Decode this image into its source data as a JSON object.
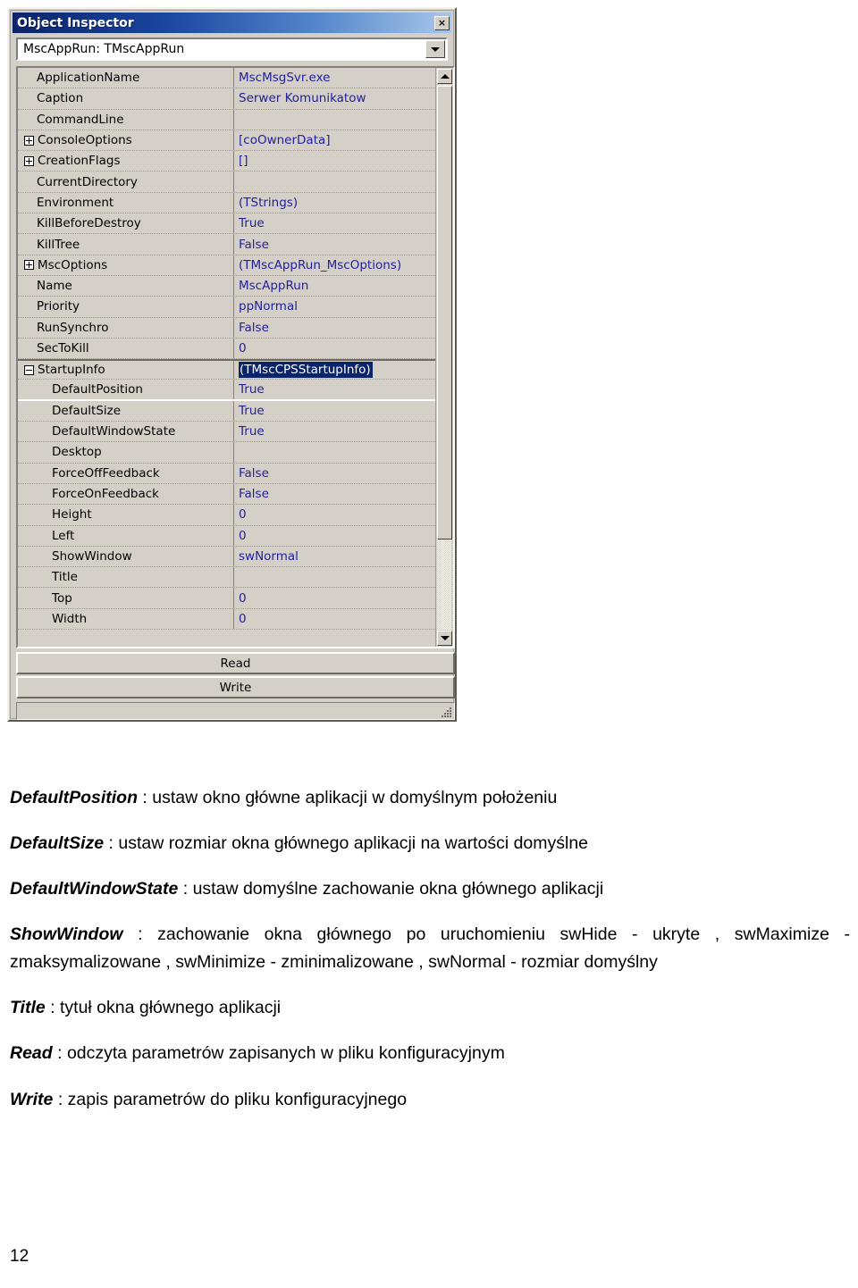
{
  "window": {
    "title": "Object Inspector",
    "close_label": "×",
    "component_selector": "MscAppRun: TMscAppRun",
    "buttons": {
      "read": "Read",
      "write": "Write"
    }
  },
  "properties": [
    {
      "name": "ApplicationName",
      "value": "MscMsgSvr.exe",
      "indent": 0,
      "expander": "",
      "selected": false
    },
    {
      "name": "Caption",
      "value": "Serwer Komunikatow",
      "indent": 0,
      "expander": "",
      "selected": false
    },
    {
      "name": "CommandLine",
      "value": "",
      "indent": 0,
      "expander": "",
      "selected": false
    },
    {
      "name": "ConsoleOptions",
      "value": "[coOwnerData]",
      "indent": 0,
      "expander": "plus",
      "selected": false
    },
    {
      "name": "CreationFlags",
      "value": "[]",
      "indent": 0,
      "expander": "plus",
      "selected": false
    },
    {
      "name": "CurrentDirectory",
      "value": "",
      "indent": 0,
      "expander": "",
      "selected": false
    },
    {
      "name": "Environment",
      "value": "(TStrings)",
      "indent": 0,
      "expander": "",
      "selected": false
    },
    {
      "name": "KillBeforeDestroy",
      "value": "True",
      "indent": 0,
      "expander": "",
      "selected": false
    },
    {
      "name": "KillTree",
      "value": "False",
      "indent": 0,
      "expander": "",
      "selected": false
    },
    {
      "name": "MscOptions",
      "value": "(TMscAppRun_MscOptions)",
      "indent": 0,
      "expander": "plus",
      "selected": false
    },
    {
      "name": "Name",
      "value": "MscAppRun",
      "indent": 0,
      "expander": "",
      "selected": false
    },
    {
      "name": "Priority",
      "value": "ppNormal",
      "indent": 0,
      "expander": "",
      "selected": false
    },
    {
      "name": "RunSynchro",
      "value": "False",
      "indent": 0,
      "expander": "",
      "selected": false
    },
    {
      "name": "SecToKill",
      "value": "0",
      "indent": 0,
      "expander": "",
      "selected": false
    },
    {
      "name": "StartupInfo",
      "value": "(TMscCPSStartupInfo)",
      "indent": 0,
      "expander": "minus",
      "selected": true
    },
    {
      "name": "DefaultPosition",
      "value": "True",
      "indent": 1,
      "expander": "",
      "selected": false
    },
    {
      "name": "DefaultSize",
      "value": "True",
      "indent": 1,
      "expander": "",
      "selected": false
    },
    {
      "name": "DefaultWindowState",
      "value": "True",
      "indent": 1,
      "expander": "",
      "selected": false
    },
    {
      "name": "Desktop",
      "value": "",
      "indent": 1,
      "expander": "",
      "selected": false
    },
    {
      "name": "ForceOffFeedback",
      "value": "False",
      "indent": 1,
      "expander": "",
      "selected": false
    },
    {
      "name": "ForceOnFeedback",
      "value": "False",
      "indent": 1,
      "expander": "",
      "selected": false
    },
    {
      "name": "Height",
      "value": "0",
      "indent": 1,
      "expander": "",
      "selected": false
    },
    {
      "name": "Left",
      "value": "0",
      "indent": 1,
      "expander": "",
      "selected": false
    },
    {
      "name": "ShowWindow",
      "value": "swNormal",
      "indent": 1,
      "expander": "",
      "selected": false
    },
    {
      "name": "Title",
      "value": "",
      "indent": 1,
      "expander": "",
      "selected": false
    },
    {
      "name": "Top",
      "value": "0",
      "indent": 1,
      "expander": "",
      "selected": false
    },
    {
      "name": "Width",
      "value": "0",
      "indent": 1,
      "expander": "",
      "selected": false
    }
  ],
  "document": {
    "paragraphs": [
      {
        "term": "DefaultPosition",
        "text": " : ustaw okno główne aplikacji w domyślnym położeniu"
      },
      {
        "term": "DefaultSize",
        "text": " : ustaw rozmiar okna głównego aplikacji na wartości domyślne"
      },
      {
        "term": "DefaultWindowState",
        "text": " : ustaw domyślne zachowanie okna głównego aplikacji"
      },
      {
        "term": "ShowWindow",
        "text": " : zachowanie okna głównego po uruchomieniu swHide - ukryte , swMaximize - zmaksymalizowane , swMinimize - zminimalizowane , swNormal - rozmiar domyślny",
        "justify": true
      },
      {
        "term": "Title",
        "text": " : tytuł okna głównego aplikacji"
      },
      {
        "term": "Read",
        "text": " : odczyta parametrów zapisanych w pliku konfiguracyjnym"
      },
      {
        "term": "Write",
        "text": " : zapis parametrów do pliku konfiguracyjnego"
      }
    ],
    "page_number": "12"
  },
  "colors": {
    "window_face": "#d4d0c8",
    "title_gradient_start": "#0a246a",
    "title_gradient_end": "#a8c6ea",
    "property_value_text": "#21219c",
    "selection_background": "#0a246a",
    "selection_text": "#ffffff"
  }
}
